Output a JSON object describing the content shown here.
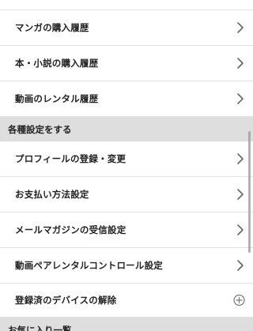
{
  "purchase_history": {
    "items": [
      {
        "label": "マンガの購入履歴",
        "icon": "chevron-right-icon"
      },
      {
        "label": "本・小説の購入履歴",
        "icon": "chevron-right-icon"
      },
      {
        "label": "動画のレンタル履歴",
        "icon": "chevron-right-icon"
      }
    ]
  },
  "settings_section": {
    "title": "各種設定をする",
    "items": [
      {
        "label": "プロフィールの登録・変更",
        "icon": "chevron-right-icon"
      },
      {
        "label": "お支払い方法設定",
        "icon": "chevron-right-icon"
      },
      {
        "label": "メールマガジンの受信設定",
        "icon": "chevron-right-icon"
      },
      {
        "label": "動画ペアレンタルコントロール設定",
        "icon": "chevron-right-icon"
      },
      {
        "label": "登録済のデバイスの解除",
        "icon": "circle-plus-icon"
      }
    ]
  },
  "favorites_section": {
    "title": "お気に入り一覧"
  },
  "colors": {
    "background": "#ffffff",
    "section_header_background": "#dedede",
    "divider": "#e3e3e3",
    "text": "#222222",
    "icon": "#666666"
  }
}
